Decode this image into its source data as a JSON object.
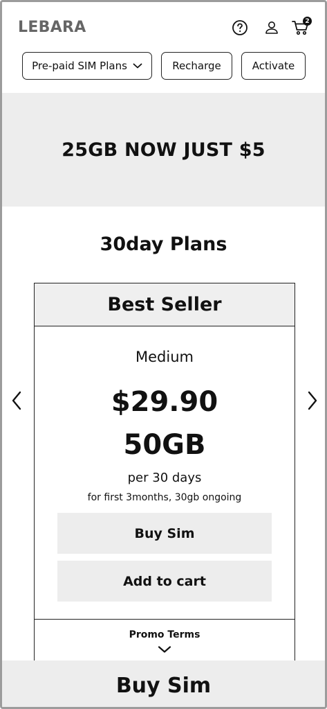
{
  "header": {
    "logo": "LEBARA",
    "cart_count": "2",
    "icons": [
      "help-icon",
      "user-icon",
      "cart-icon"
    ]
  },
  "nav": {
    "plans_label": "Pre-paid SIM Plans",
    "recharge_label": "Recharge",
    "activate_label": "Activate"
  },
  "promo": {
    "text": "25GB NOW JUST $5"
  },
  "section": {
    "title": "30day Plans"
  },
  "plan": {
    "badge": "Best Seller",
    "name": "Medium",
    "price": "$29.90",
    "data": "50GB",
    "period": "per 30 days",
    "note": "for first 3months, 30gb ongoing",
    "buy_label": "Buy Sim",
    "cart_label": "Add to cart",
    "terms_label": "Promo Terms"
  },
  "bottom": {
    "buy_label": "Buy Sim"
  },
  "colors": {
    "panel_gray": "#ededed",
    "logo_gray": "#666666",
    "text": "#111111"
  }
}
